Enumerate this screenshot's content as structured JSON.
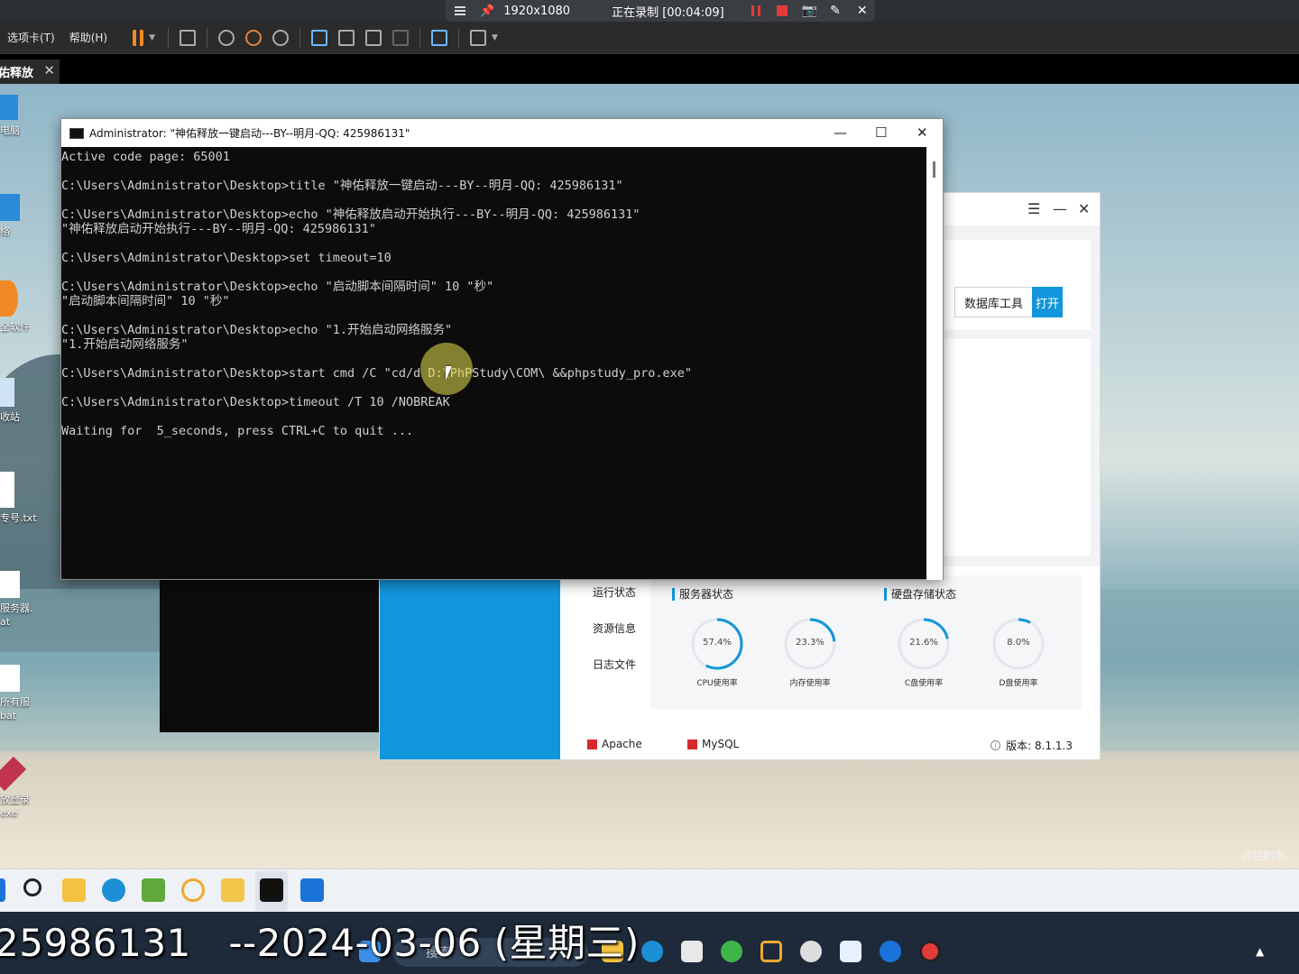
{
  "recorder": {
    "resolution": "1920x1080",
    "status": "正在录制 [00:04:09]"
  },
  "toolbar": {
    "menu_tabs": "选项卡(T)",
    "menu_help": "帮助(H)"
  },
  "session_tab": {
    "label": "佑释放"
  },
  "desktop": {
    "icons": [
      {
        "label": "电脑"
      },
      {
        "label": "络"
      },
      {
        "label": "全软件"
      },
      {
        "label": "收站"
      },
      {
        "label": "专号.txt"
      },
      {
        "label": "服务器."
      },
      {
        "label": "at"
      },
      {
        "label": "所有服"
      },
      {
        "label": "bat"
      },
      {
        "label": "放登录"
      },
      {
        "label": "exe"
      }
    ],
    "watermark": "评估副本。"
  },
  "cmd": {
    "title": "Administrator: \"神佑释放一键启动---BY--明月-QQ: 425986131\"",
    "lines": [
      "Active code page: 65001",
      "",
      "C:\\Users\\Administrator\\Desktop>title \"神佑释放一键启动---BY--明月-QQ: 425986131\"",
      "",
      "C:\\Users\\Administrator\\Desktop>echo \"神佑释放启动开始执行---BY--明月-QQ: 425986131\"",
      "\"神佑释放启动开始执行---BY--明月-QQ: 425986131\"",
      "",
      "C:\\Users\\Administrator\\Desktop>set timeout=10",
      "",
      "C:\\Users\\Administrator\\Desktop>echo \"启动脚本间隔时间\" 10 \"秒\"",
      "\"启动脚本间隔时间\" 10 \"秒\"",
      "",
      "C:\\Users\\Administrator\\Desktop>echo \"1.开始启动网络服务\"",
      "\"1.开始启动网络服务\"",
      "",
      "C:\\Users\\Administrator\\Desktop>start cmd /C \"cd/d D:\\PhPStudy\\COM\\ &&phpstudy_pro.exe\"",
      "",
      "C:\\Users\\Administrator\\Desktop>timeout /T 10 /NOBREAK",
      "",
      "Waiting for  5_seconds, press CTRL+C to quit ..."
    ]
  },
  "phpstudy": {
    "db_tool_label": "数据库工具",
    "open_label": "打开",
    "menu": [
      "运行状态",
      "资源信息",
      "日志文件"
    ],
    "server_status_title": "服务器状态",
    "disk_status_title": "硬盘存储状态",
    "gauges": [
      {
        "value": "57.4%",
        "fraction": 0.574,
        "caption": "CPU使用率"
      },
      {
        "value": "23.3%",
        "fraction": 0.233,
        "caption": "内存使用率"
      },
      {
        "value": "21.6%",
        "fraction": 0.216,
        "caption": "C盘使用率"
      },
      {
        "value": "8.0%",
        "fraction": 0.08,
        "caption": "D盘使用率"
      }
    ],
    "services": [
      "Apache",
      "MySQL"
    ],
    "version": "版本: 8.1.1.3",
    "accent": "#1296db",
    "service_stopped_color": "#d9272e"
  },
  "subtitle": {
    "text": "25986131   --2024-03-06 (星期三)"
  },
  "taskbar": {
    "search_placeholder": "搜索"
  }
}
